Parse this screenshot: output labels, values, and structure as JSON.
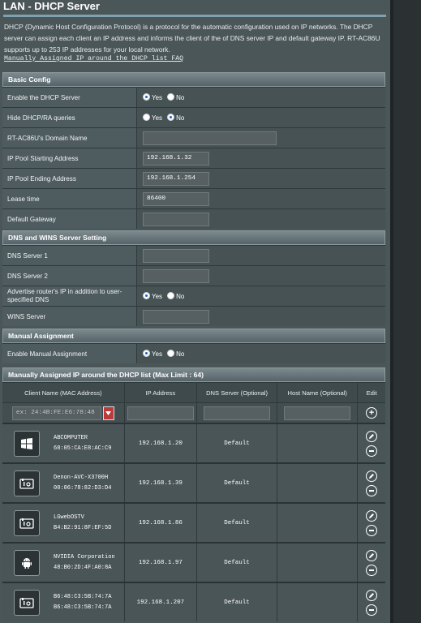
{
  "page": {
    "title": "LAN - DHCP Server",
    "description": "DHCP (Dynamic Host Configuration Protocol) is a protocol for the automatic configuration used on IP networks. The DHCP server can assign each client an IP address and informs the client of the of DNS server IP and default gateway IP. RT-AC86U supports up to 253 IP addresses for your local network.",
    "faq_link": "Manually Assigned IP around the DHCP list FAQ"
  },
  "basic": {
    "header": "Basic Config",
    "rows": [
      {
        "label": "Enable the DHCP Server",
        "type": "radio",
        "yes": "Yes",
        "no": "No",
        "selected": "yes"
      },
      {
        "label": "Hide DHCP/RA queries",
        "type": "radio",
        "yes": "Yes",
        "no": "No",
        "selected": "no"
      },
      {
        "label": "RT-AC86U's Domain Name",
        "type": "input",
        "value": ""
      },
      {
        "label": "IP Pool Starting Address",
        "type": "input",
        "value": "192.168.1.32"
      },
      {
        "label": "IP Pool Ending Address",
        "type": "input",
        "value": "192.168.1.254"
      },
      {
        "label": "Lease time",
        "type": "input",
        "value": "86400"
      },
      {
        "label": "Default Gateway",
        "type": "input",
        "value": ""
      }
    ]
  },
  "dns": {
    "header": "DNS and WINS Server Setting",
    "rows": [
      {
        "label": "DNS Server 1",
        "value": ""
      },
      {
        "label": "DNS Server 2",
        "value": ""
      },
      {
        "label": "Advertise router's IP in addition to user-specified DNS",
        "yes": "Yes",
        "no": "No",
        "selected": "yes"
      },
      {
        "label": "WINS Server",
        "value": ""
      }
    ]
  },
  "manual": {
    "header": "Manual Assignment",
    "enable_label": "Enable Manual Assignment",
    "yes": "Yes",
    "no": "No",
    "selected": "yes"
  },
  "list": {
    "header": "Manually Assigned IP around the DHCP list (Max Limit : 64)",
    "columns": [
      "Client Name (MAC Address)",
      "IP Address",
      "DNS Server (Optional)",
      "Host Name (Optional)",
      "Edit"
    ],
    "mac_placeholder": "ex: 24:4B:FE:E6:78:48",
    "clients": [
      {
        "icon": "windows-icon",
        "name": "ABCOMPUTER",
        "mac": "68:05:CA:E8:AC:C9",
        "ip": "192.168.1.20",
        "dns": "Default"
      },
      {
        "icon": "media-device-icon",
        "name": "Denon-AVC-X3700H",
        "mac": "00:06:78:82:D3:D4",
        "ip": "192.168.1.39",
        "dns": "Default"
      },
      {
        "icon": "media-device-icon",
        "name": "LGwebOSTV",
        "mac": "B4:B2:91:8F:EF:5D",
        "ip": "192.168.1.86",
        "dns": "Default"
      },
      {
        "icon": "android-icon",
        "name": "NVIDIA Corporation",
        "mac": "48:B0:2D:4F:A0:8A",
        "ip": "192.168.1.97",
        "dns": "Default"
      },
      {
        "icon": "media-device-icon",
        "name": "B6:48:C3:5B:74:7A",
        "mac": "B6:48:C3:5B:74:7A",
        "ip": "192.168.1.207",
        "dns": "Default"
      }
    ]
  },
  "colors": {
    "accent": "#1766c1",
    "panel": "#4b5659",
    "header": "#56646a"
  }
}
